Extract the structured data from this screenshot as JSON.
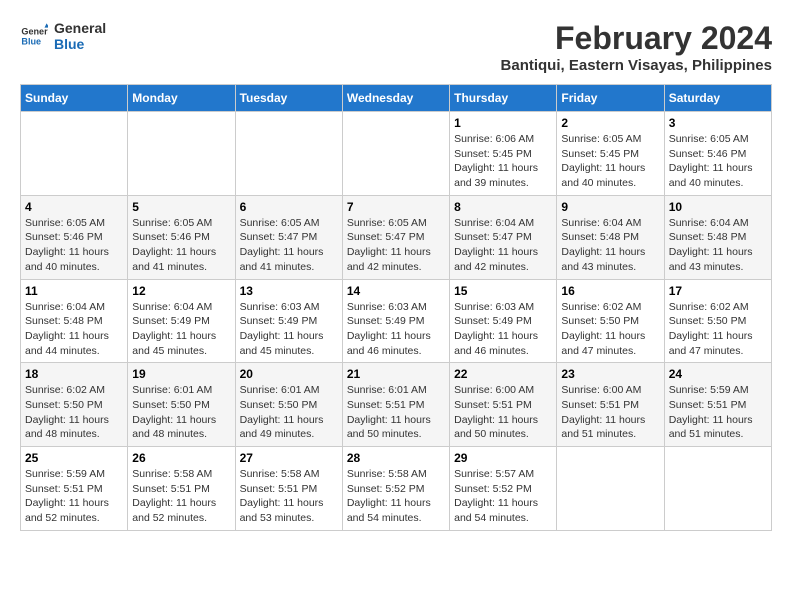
{
  "logo": {
    "line1": "General",
    "line2": "Blue"
  },
  "title": "February 2024",
  "subtitle": "Bantiqui, Eastern Visayas, Philippines",
  "weekdays": [
    "Sunday",
    "Monday",
    "Tuesday",
    "Wednesday",
    "Thursday",
    "Friday",
    "Saturday"
  ],
  "weeks": [
    [
      {
        "day": "",
        "content": ""
      },
      {
        "day": "",
        "content": ""
      },
      {
        "day": "",
        "content": ""
      },
      {
        "day": "",
        "content": ""
      },
      {
        "day": "1",
        "content": "Sunrise: 6:06 AM\nSunset: 5:45 PM\nDaylight: 11 hours\nand 39 minutes."
      },
      {
        "day": "2",
        "content": "Sunrise: 6:05 AM\nSunset: 5:45 PM\nDaylight: 11 hours\nand 40 minutes."
      },
      {
        "day": "3",
        "content": "Sunrise: 6:05 AM\nSunset: 5:46 PM\nDaylight: 11 hours\nand 40 minutes."
      }
    ],
    [
      {
        "day": "4",
        "content": "Sunrise: 6:05 AM\nSunset: 5:46 PM\nDaylight: 11 hours\nand 40 minutes."
      },
      {
        "day": "5",
        "content": "Sunrise: 6:05 AM\nSunset: 5:46 PM\nDaylight: 11 hours\nand 41 minutes."
      },
      {
        "day": "6",
        "content": "Sunrise: 6:05 AM\nSunset: 5:47 PM\nDaylight: 11 hours\nand 41 minutes."
      },
      {
        "day": "7",
        "content": "Sunrise: 6:05 AM\nSunset: 5:47 PM\nDaylight: 11 hours\nand 42 minutes."
      },
      {
        "day": "8",
        "content": "Sunrise: 6:04 AM\nSunset: 5:47 PM\nDaylight: 11 hours\nand 42 minutes."
      },
      {
        "day": "9",
        "content": "Sunrise: 6:04 AM\nSunset: 5:48 PM\nDaylight: 11 hours\nand 43 minutes."
      },
      {
        "day": "10",
        "content": "Sunrise: 6:04 AM\nSunset: 5:48 PM\nDaylight: 11 hours\nand 43 minutes."
      }
    ],
    [
      {
        "day": "11",
        "content": "Sunrise: 6:04 AM\nSunset: 5:48 PM\nDaylight: 11 hours\nand 44 minutes."
      },
      {
        "day": "12",
        "content": "Sunrise: 6:04 AM\nSunset: 5:49 PM\nDaylight: 11 hours\nand 45 minutes."
      },
      {
        "day": "13",
        "content": "Sunrise: 6:03 AM\nSunset: 5:49 PM\nDaylight: 11 hours\nand 45 minutes."
      },
      {
        "day": "14",
        "content": "Sunrise: 6:03 AM\nSunset: 5:49 PM\nDaylight: 11 hours\nand 46 minutes."
      },
      {
        "day": "15",
        "content": "Sunrise: 6:03 AM\nSunset: 5:49 PM\nDaylight: 11 hours\nand 46 minutes."
      },
      {
        "day": "16",
        "content": "Sunrise: 6:02 AM\nSunset: 5:50 PM\nDaylight: 11 hours\nand 47 minutes."
      },
      {
        "day": "17",
        "content": "Sunrise: 6:02 AM\nSunset: 5:50 PM\nDaylight: 11 hours\nand 47 minutes."
      }
    ],
    [
      {
        "day": "18",
        "content": "Sunrise: 6:02 AM\nSunset: 5:50 PM\nDaylight: 11 hours\nand 48 minutes."
      },
      {
        "day": "19",
        "content": "Sunrise: 6:01 AM\nSunset: 5:50 PM\nDaylight: 11 hours\nand 48 minutes."
      },
      {
        "day": "20",
        "content": "Sunrise: 6:01 AM\nSunset: 5:50 PM\nDaylight: 11 hours\nand 49 minutes."
      },
      {
        "day": "21",
        "content": "Sunrise: 6:01 AM\nSunset: 5:51 PM\nDaylight: 11 hours\nand 50 minutes."
      },
      {
        "day": "22",
        "content": "Sunrise: 6:00 AM\nSunset: 5:51 PM\nDaylight: 11 hours\nand 50 minutes."
      },
      {
        "day": "23",
        "content": "Sunrise: 6:00 AM\nSunset: 5:51 PM\nDaylight: 11 hours\nand 51 minutes."
      },
      {
        "day": "24",
        "content": "Sunrise: 5:59 AM\nSunset: 5:51 PM\nDaylight: 11 hours\nand 51 minutes."
      }
    ],
    [
      {
        "day": "25",
        "content": "Sunrise: 5:59 AM\nSunset: 5:51 PM\nDaylight: 11 hours\nand 52 minutes."
      },
      {
        "day": "26",
        "content": "Sunrise: 5:58 AM\nSunset: 5:51 PM\nDaylight: 11 hours\nand 52 minutes."
      },
      {
        "day": "27",
        "content": "Sunrise: 5:58 AM\nSunset: 5:51 PM\nDaylight: 11 hours\nand 53 minutes."
      },
      {
        "day": "28",
        "content": "Sunrise: 5:58 AM\nSunset: 5:52 PM\nDaylight: 11 hours\nand 54 minutes."
      },
      {
        "day": "29",
        "content": "Sunrise: 5:57 AM\nSunset: 5:52 PM\nDaylight: 11 hours\nand 54 minutes."
      },
      {
        "day": "",
        "content": ""
      },
      {
        "day": "",
        "content": ""
      }
    ]
  ]
}
